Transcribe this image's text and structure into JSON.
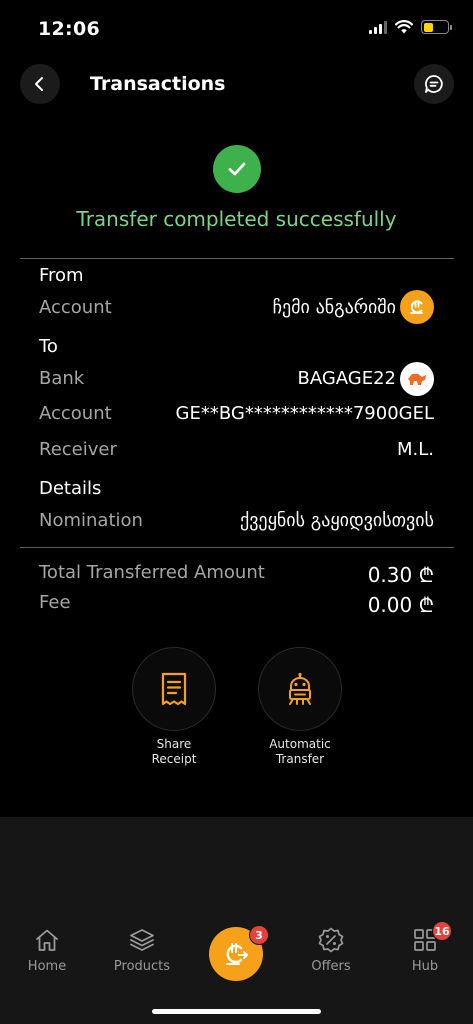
{
  "status_bar": {
    "time": "12:06",
    "battery_color": "#ffd60a"
  },
  "header": {
    "title": "Transactions",
    "back_icon": "chevron-left-icon",
    "chat_icon": "chat-icon"
  },
  "success": {
    "message": "Transfer completed successfully",
    "icon": "check-icon",
    "color": "#3fb14c"
  },
  "from": {
    "title": "From",
    "account_label": "Account",
    "account_value": "ჩემი ანგარიში",
    "account_icon": "gel-currency-icon"
  },
  "to": {
    "title": "To",
    "bank_label": "Bank",
    "bank_value": "BAGAGE22",
    "bank_icon": "bank-logo-icon",
    "account_label": "Account",
    "account_value": "GE**BG************7900GEL",
    "receiver_label": "Receiver",
    "receiver_value": "M.L."
  },
  "details": {
    "title": "Details",
    "nomination_label": "Nomination",
    "nomination_value": "ქვეყნის გაყიდვისთვის"
  },
  "totals": {
    "total_label": "Total Transferred Amount",
    "total_value": "0.30 ₾",
    "fee_label": "Fee",
    "fee_value": "0.00 ₾"
  },
  "actions": [
    {
      "label": "Share\nReceipt",
      "icon": "receipt-icon"
    },
    {
      "label": "Automatic\nTransfer",
      "icon": "robot-icon"
    }
  ],
  "tabs": [
    {
      "label": "Home",
      "icon": "home-icon"
    },
    {
      "label": "Products",
      "icon": "layers-icon"
    },
    {
      "label": "Offers",
      "icon": "percent-badge-icon"
    },
    {
      "label": "Hub",
      "icon": "grid-icon",
      "badge": "16"
    }
  ],
  "fab": {
    "icon": "transfer-icon",
    "badge": "3",
    "color": "#f5a11a"
  }
}
